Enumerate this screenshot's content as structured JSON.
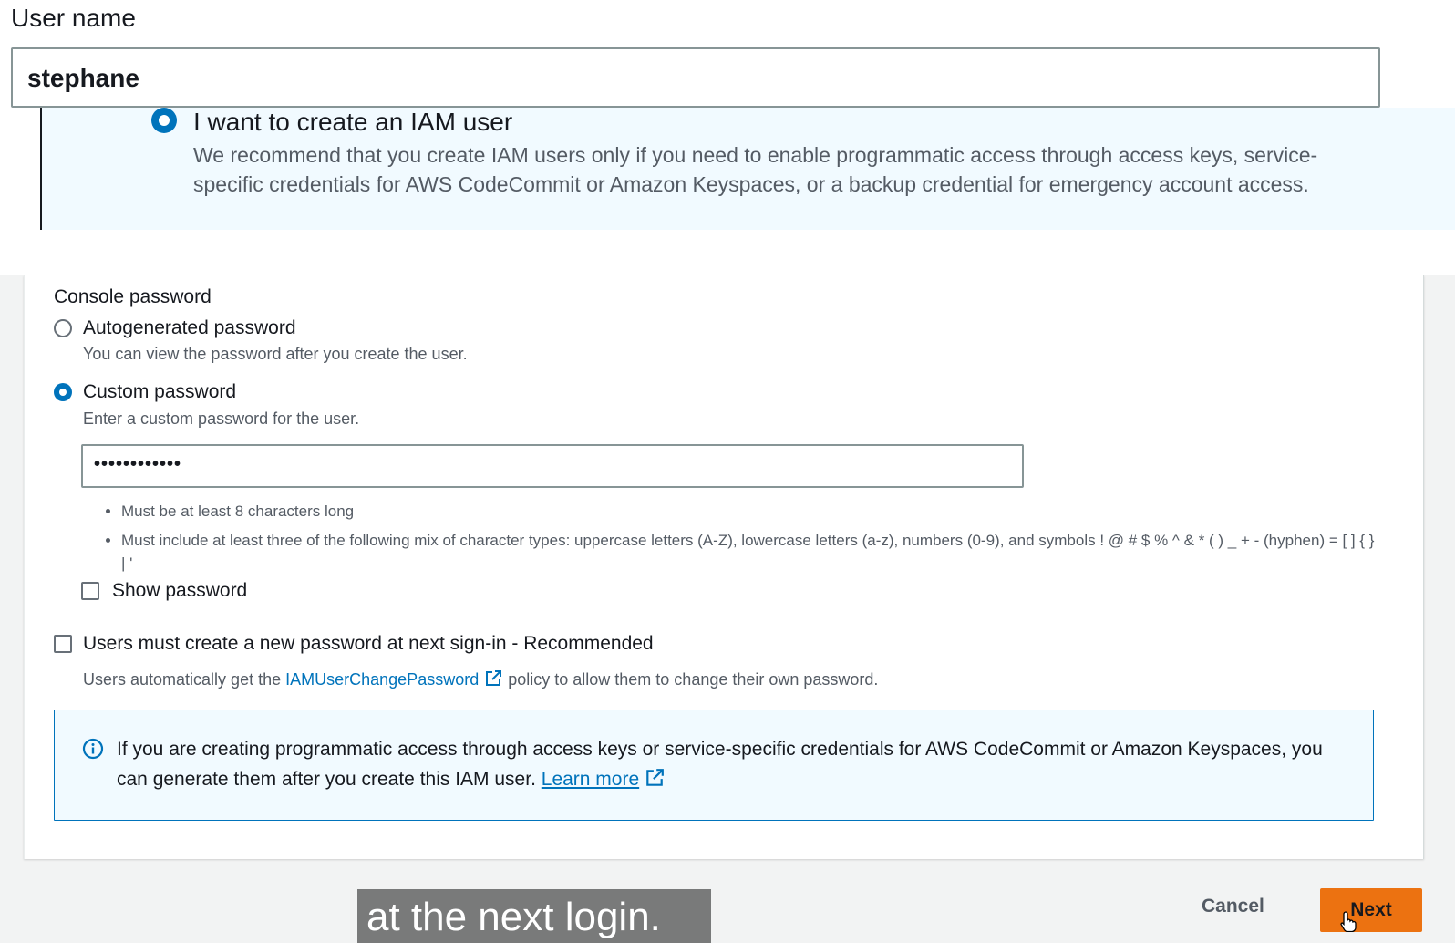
{
  "user_name": {
    "label": "User name",
    "value": "stephane"
  },
  "iam_option": {
    "title": "I want to create an IAM user",
    "description": "We recommend that you create IAM users only if you need to enable programmatic access through access keys, service-specific credentials for AWS CodeCommit or Amazon Keyspaces, or a backup credential for emergency account access.",
    "selected": true
  },
  "console_password": {
    "label": "Console password",
    "options": [
      {
        "label": "Autogenerated password",
        "description": "You can view the password after you create the user.",
        "selected": false
      },
      {
        "label": "Custom password",
        "description": "Enter a custom password for the user.",
        "selected": true
      }
    ],
    "password_value": "••••••••••••",
    "rules": [
      "Must be at least 8 characters long",
      "Must include at least three of the following mix of character types: uppercase letters (A-Z), lowercase letters (a-z), numbers (0-9), and symbols ! @ # $ % ^ & * ( ) _ + - (hyphen) = [ ] { } | '"
    ],
    "show_password_label": "Show password"
  },
  "reset_option": {
    "label": "Users must create a new password at next sign-in - Recommended",
    "desc_before": "Users automatically get the",
    "policy_link": "IAMUserChangePassword",
    "desc_after": "policy to allow them to change their own password."
  },
  "info_box": {
    "text": "If you are creating programmatic access through access keys or service-specific credentials for AWS CodeCommit or Amazon Keyspaces, you can generate them after you create this IAM user.",
    "link": "Learn more"
  },
  "caption": "at the next login.",
  "footer": {
    "cancel_label": "Cancel",
    "next_label": "Next"
  },
  "colors": {
    "accent": "#0073bb",
    "primary_button": "#ec7211",
    "info_bg": "#f1faff"
  }
}
